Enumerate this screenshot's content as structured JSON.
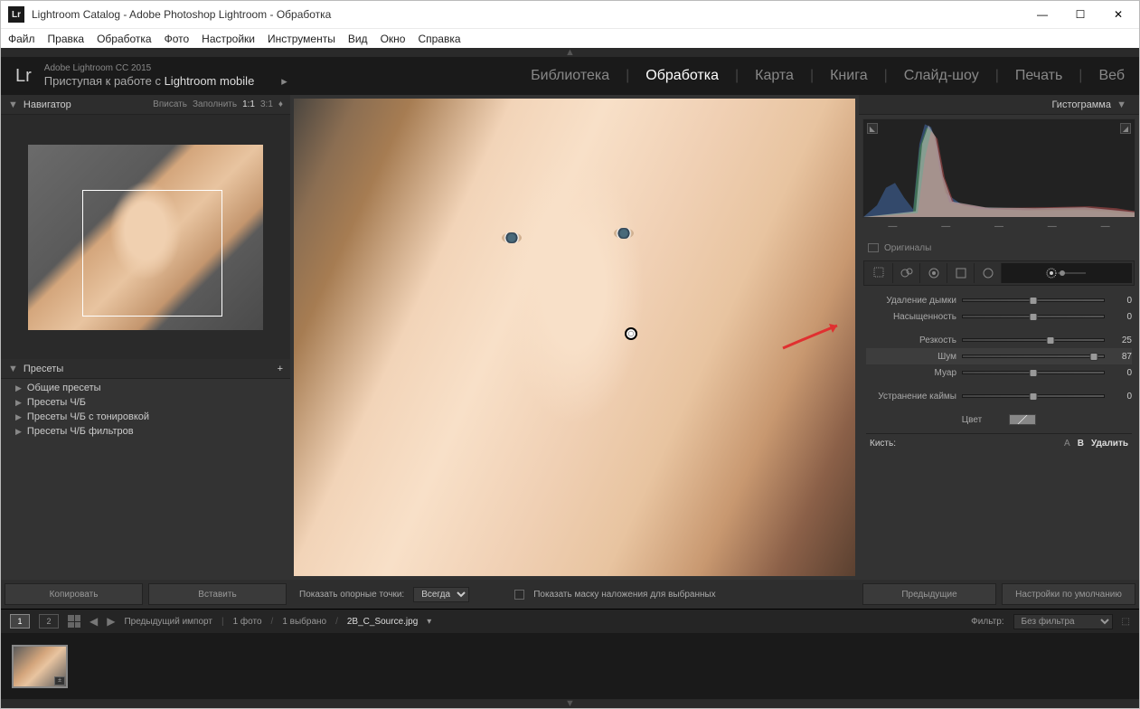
{
  "window": {
    "title": "Lightroom Catalog - Adobe Photoshop Lightroom - Обработка",
    "logo": "Lr"
  },
  "menubar": [
    "Файл",
    "Правка",
    "Обработка",
    "Фото",
    "Настройки",
    "Инструменты",
    "Вид",
    "Окно",
    "Справка"
  ],
  "header": {
    "brand_line1": "Adobe Lightroom CC 2015",
    "brand_line2_a": "Приступая к работе с ",
    "brand_line2_b": "Lightroom mobile",
    "arrow": "▸"
  },
  "modules": [
    "Библиотека",
    "Обработка",
    "Карта",
    "Книга",
    "Слайд-шоу",
    "Печать",
    "Веб"
  ],
  "nav_panel": {
    "title": "Навигатор",
    "opts": [
      "Вписать",
      "Заполнить",
      "1:1",
      "3:1"
    ]
  },
  "presets": {
    "title": "Пресеты",
    "items": [
      "Общие пресеты",
      "Пресеты Ч/Б",
      "Пресеты Ч/Б с тонировкой",
      "Пресеты Ч/Б фильтров"
    ]
  },
  "left_buttons": {
    "copy": "Копировать",
    "paste": "Вставить"
  },
  "center_bar": {
    "show_pins": "Показать опорные точки:",
    "always": "Всегда",
    "show_mask": "Показать маску наложения для выбранных"
  },
  "right_panel": {
    "hist": "Гистограмма",
    "originals": "Оригиналы",
    "sliders": [
      {
        "label": "Удаление дымки",
        "val": "0",
        "pos": 50
      },
      {
        "label": "Насыщенность",
        "val": "0",
        "pos": 50
      },
      {
        "label": "Резкость",
        "val": "25",
        "pos": 62
      },
      {
        "label": "Шум",
        "val": "87",
        "pos": 93
      },
      {
        "label": "Муар",
        "val": "0",
        "pos": 50
      },
      {
        "label": "Устранение каймы",
        "val": "0",
        "pos": 50
      }
    ],
    "color": "Цвет",
    "brush": "Кисть:",
    "brush_a": "A",
    "brush_b": "B",
    "brush_del": "Удалить",
    "btn_prev": "Предыдущие",
    "btn_reset": "Настройки по умолчанию"
  },
  "filmstrip": {
    "view1": "1",
    "view2": "2",
    "prev_import": "Предыдущий импорт",
    "count": "1 фото",
    "sel": "1 выбрано",
    "file": "2B_C_Source.jpg",
    "filter_lbl": "Фильтр:",
    "filter_none": "Без фильтра"
  }
}
